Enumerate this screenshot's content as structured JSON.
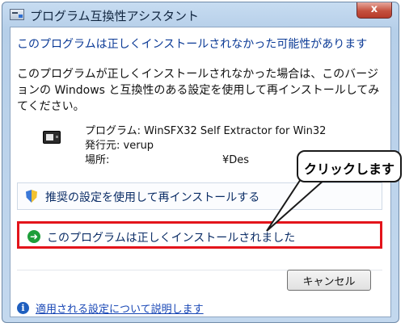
{
  "window": {
    "title": "プログラム互換性アシスタント",
    "close_label": "x"
  },
  "main": {
    "heading": "このプログラムは正しくインストールされなかった可能性があります",
    "message": "このプログラムが正しくインストールされなかった場合は、このバージョンの Windows と互換性のある設定を使用して再インストールしてみてください。",
    "program": {
      "name_label": "プログラム:",
      "name_value": "WinSFX32 Self Extractor for Win32",
      "publisher_label": "発行元:",
      "publisher_value": "verup",
      "location_label": "場所:",
      "location_value": "¥Des"
    },
    "options": [
      {
        "label": "推奨の設定を使用して再インストールする",
        "icon": "shield-icon"
      },
      {
        "label": "このプログラムは正しくインストールされました",
        "icon": "green-arrow-icon"
      }
    ],
    "cancel_label": "キャンセル",
    "footer_link": "適用される設定について説明します"
  },
  "callout": {
    "text": "クリックします"
  },
  "colors": {
    "highlight_border": "#e3141b",
    "heading_blue": "#0b3a96",
    "link_blue": "#1746b5"
  }
}
